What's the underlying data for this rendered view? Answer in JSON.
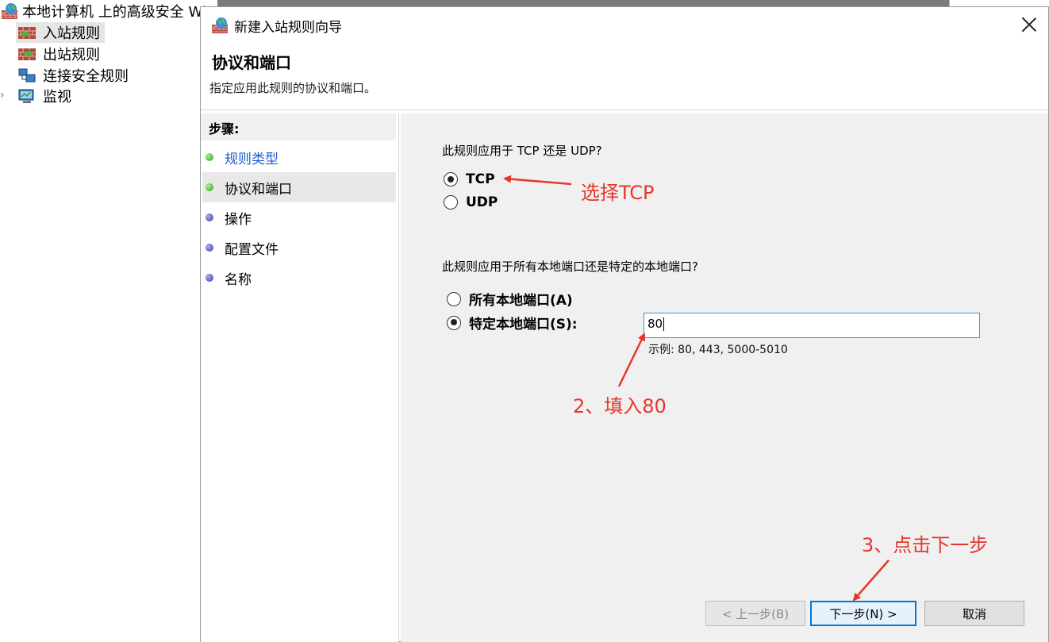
{
  "tree": {
    "root_label": "本地计算机 上的高级安全 Wi",
    "items": [
      {
        "label": "入站规则",
        "icon": "inbound-rules-icon",
        "selected": true
      },
      {
        "label": "出站规则",
        "icon": "outbound-rules-icon",
        "selected": false
      },
      {
        "label": "连接安全规则",
        "icon": "connection-security-icon",
        "selected": false
      },
      {
        "label": "监视",
        "icon": "monitor-icon",
        "selected": false
      }
    ]
  },
  "dialog": {
    "title": "新建入站规则向导",
    "heading": "协议和端口",
    "subheading": "指定应用此规则的协议和端口。",
    "steps_header": "步骤:",
    "steps": [
      {
        "label": "规则类型",
        "status": "completed",
        "dot_color": "#3aaa2a"
      },
      {
        "label": "协议和端口",
        "status": "current",
        "dot_color": "#3aaa2a"
      },
      {
        "label": "操作",
        "status": "pending",
        "dot_color": "#4646b8"
      },
      {
        "label": "配置文件",
        "status": "pending",
        "dot_color": "#4646b8"
      },
      {
        "label": "名称",
        "status": "pending",
        "dot_color": "#4646b8"
      }
    ],
    "protocol_question": "此规则应用于 TCP 还是 UDP?",
    "protocol_options": [
      {
        "label": "TCP",
        "selected": true
      },
      {
        "label": "UDP",
        "selected": false
      }
    ],
    "port_question": "此规则应用于所有本地端口还是特定的本地端口?",
    "port_options": [
      {
        "label": "所有本地端口(A)",
        "selected": false
      },
      {
        "label": "特定本地端口(S):",
        "selected": true
      }
    ],
    "port_value": "80",
    "port_example": "示例: 80, 443, 5000-5010",
    "buttons": {
      "back": "< 上一步(B)",
      "next": "下一步(N) >",
      "cancel": "取消"
    }
  },
  "annotations": {
    "step1": "选择TCP",
    "step2": "2、填入80",
    "step3": "3、点击下一步",
    "color": "#e8352b"
  }
}
